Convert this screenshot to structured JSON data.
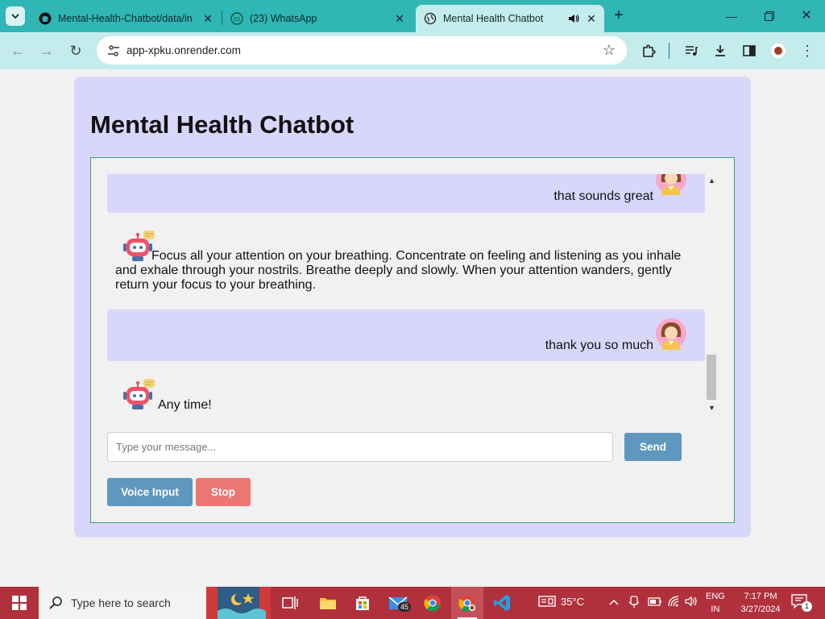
{
  "browser": {
    "tabs": [
      {
        "title": "Mental-Health-Chatbot/data/in",
        "icon": "github-icon",
        "active": false
      },
      {
        "title": "(23) WhatsApp",
        "icon": "whatsapp-icon",
        "active": false
      },
      {
        "title": "Mental Health Chatbot",
        "icon": "globe-icon",
        "active": true
      }
    ],
    "whatsapp_badge": "23",
    "url": "app-xpku.onrender.com"
  },
  "page": {
    "title": "Mental Health Chatbot",
    "messages": [
      {
        "sender": "user",
        "text": "that sounds great"
      },
      {
        "sender": "bot",
        "text": "Focus all your attention on your breathing. Concentrate on feeling and listening as you inhale and exhale through your nostrils. Breathe deeply and slowly. When your attention wanders, gently return your focus to your breathing."
      },
      {
        "sender": "user",
        "text": "thank you so much"
      },
      {
        "sender": "bot",
        "text": "Any time!"
      }
    ],
    "input_placeholder": "Type your message...",
    "send_label": "Send",
    "voice_label": "Voice Input",
    "stop_label": "Stop",
    "colors": {
      "card_bg": "#d8d6fb",
      "user_bubble": "#d8d6fb",
      "primary_button": "#5f97be",
      "stop_button": "#ec7672",
      "chat_border": "#3aa37a"
    }
  },
  "taskbar": {
    "search_placeholder": "Type here to search",
    "mail_badge": "45",
    "weather": "35°C",
    "lang_top": "ENG",
    "lang_bottom": "IN",
    "time": "7:17 PM",
    "date": "3/27/2024",
    "notifications": "1",
    "color": "#b0303c"
  }
}
